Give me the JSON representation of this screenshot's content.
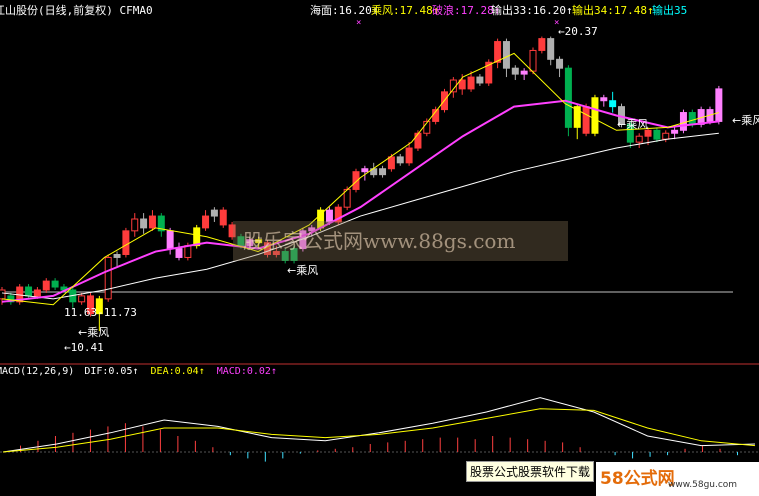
{
  "header": {
    "title": "江山股份(日线,前复权)",
    "indicator": "CFMA0",
    "items": [
      {
        "label": "海面:16.20↑",
        "color": "#ffffff"
      },
      {
        "label": "乘风:17.48↑",
        "color": "#ffff00"
      },
      {
        "label": "破浪:17.28↑",
        "color": "#ff40ff"
      },
      {
        "label": "输出33:16.20↑",
        "color": "#ffffff"
      },
      {
        "label": "输出34:17.48↑",
        "color": "#ffff00"
      },
      {
        "label": "输出35",
        "color": "#00ffff"
      }
    ]
  },
  "macd_header": {
    "name": "MACD(12,26,9)",
    "dif": "DIF:0.05↑",
    "dea": "DEA:0.04↑",
    "macd": "MACD:0.02↑"
  },
  "annotations": {
    "high": "20.37",
    "low": "10.41",
    "range": "11.63-11.73",
    "chengfeng": "乘风"
  },
  "watermark": "股乐家公式网www.88gs.com",
  "footer_text": "股票公式股票软件下载",
  "logo": {
    "brand": "58公式网",
    "site": "www.58gu.com"
  },
  "colors": {
    "up": "#ff3c3c",
    "down": "#00b050",
    "yellow": "#ffff00",
    "magenta": "#ff40ff",
    "white": "#ffffff",
    "cyan": "#00ffff",
    "pink": "#ff80ff",
    "gray": "#b0b0b0"
  },
  "chart_data": {
    "type": "candlestick",
    "ylim": [
      9.5,
      21.2
    ],
    "baseline_price": 11.73,
    "candles": [
      [
        11.5,
        11.8,
        11.3,
        11.9,
        "red"
      ],
      [
        11.6,
        11.4,
        11.3,
        11.7,
        "green"
      ],
      [
        11.4,
        11.9,
        11.3,
        12.0,
        "red"
      ],
      [
        11.9,
        11.6,
        11.5,
        12.0,
        "green"
      ],
      [
        11.6,
        11.8,
        11.5,
        11.9,
        "red"
      ],
      [
        11.8,
        12.1,
        11.7,
        12.2,
        "red"
      ],
      [
        12.1,
        11.9,
        11.8,
        12.2,
        "green"
      ],
      [
        11.9,
        11.8,
        11.7,
        12.0,
        "green"
      ],
      [
        11.8,
        11.4,
        11.2,
        11.9,
        "green"
      ],
      [
        11.4,
        11.6,
        11.3,
        11.7,
        "red"
      ],
      [
        11.6,
        11.0,
        10.9,
        11.7,
        "red"
      ],
      [
        11.0,
        11.5,
        10.41,
        11.6,
        "yellow"
      ],
      [
        11.5,
        12.9,
        11.4,
        13.0,
        "red"
      ],
      [
        12.9,
        13.0,
        12.6,
        13.1,
        "gray"
      ],
      [
        13.0,
        13.8,
        12.9,
        13.9,
        "red"
      ],
      [
        13.8,
        14.2,
        13.6,
        14.4,
        "red"
      ],
      [
        14.2,
        13.9,
        13.7,
        14.4,
        "gray"
      ],
      [
        13.9,
        14.3,
        13.8,
        14.5,
        "red"
      ],
      [
        14.3,
        13.8,
        13.6,
        14.4,
        "green"
      ],
      [
        13.8,
        13.2,
        13.0,
        13.9,
        "pink"
      ],
      [
        13.2,
        12.9,
        12.8,
        13.4,
        "pink"
      ],
      [
        12.9,
        13.3,
        12.8,
        13.4,
        "red"
      ],
      [
        13.3,
        13.9,
        13.2,
        14.0,
        "yellow"
      ],
      [
        13.9,
        14.3,
        13.8,
        14.5,
        "red"
      ],
      [
        14.3,
        14.5,
        14.1,
        14.6,
        "gray"
      ],
      [
        14.5,
        14.0,
        13.9,
        14.6,
        "red"
      ],
      [
        14.0,
        13.6,
        13.5,
        14.1,
        "red"
      ],
      [
        13.6,
        13.3,
        13.2,
        13.7,
        "green"
      ],
      [
        13.3,
        13.5,
        13.2,
        13.6,
        "pink"
      ],
      [
        13.5,
        13.4,
        13.2,
        13.6,
        "yellow"
      ],
      [
        13.4,
        13.0,
        12.9,
        13.5,
        "red"
      ],
      [
        13.0,
        13.1,
        12.9,
        13.3,
        "red"
      ],
      [
        13.1,
        12.8,
        12.7,
        13.2,
        "green"
      ],
      [
        12.8,
        13.2,
        12.7,
        13.3,
        "green"
      ],
      [
        13.2,
        13.8,
        13.1,
        13.9,
        "pink"
      ],
      [
        13.8,
        13.9,
        13.6,
        14.0,
        "pink"
      ],
      [
        13.9,
        14.5,
        13.8,
        14.6,
        "yellow"
      ],
      [
        14.5,
        14.1,
        14.0,
        14.6,
        "pink"
      ],
      [
        14.1,
        14.6,
        14.0,
        14.7,
        "red"
      ],
      [
        14.6,
        15.2,
        14.5,
        15.3,
        "red"
      ],
      [
        15.2,
        15.8,
        15.1,
        15.9,
        "red"
      ],
      [
        15.8,
        15.9,
        15.5,
        16.0,
        "pink"
      ],
      [
        15.9,
        15.7,
        15.6,
        16.1,
        "gray"
      ],
      [
        15.7,
        15.9,
        15.6,
        16.0,
        "gray"
      ],
      [
        15.9,
        16.3,
        15.8,
        16.4,
        "red"
      ],
      [
        16.3,
        16.1,
        16.0,
        16.4,
        "gray"
      ],
      [
        16.1,
        16.6,
        16.0,
        16.8,
        "red"
      ],
      [
        16.6,
        17.1,
        16.5,
        17.2,
        "red"
      ],
      [
        17.1,
        17.5,
        17.0,
        17.6,
        "red"
      ],
      [
        17.5,
        17.9,
        17.4,
        18.0,
        "red"
      ],
      [
        17.9,
        18.5,
        17.8,
        18.6,
        "red"
      ],
      [
        18.5,
        18.9,
        18.3,
        19.0,
        "red"
      ],
      [
        18.9,
        18.6,
        18.4,
        19.1,
        "red"
      ],
      [
        18.6,
        19.0,
        18.5,
        19.2,
        "red"
      ],
      [
        19.0,
        18.8,
        18.7,
        19.1,
        "gray"
      ],
      [
        18.8,
        19.5,
        18.7,
        19.6,
        "red"
      ],
      [
        19.5,
        20.2,
        19.3,
        20.3,
        "red"
      ],
      [
        20.2,
        19.3,
        19.0,
        20.3,
        "gray"
      ],
      [
        19.3,
        19.1,
        18.9,
        19.4,
        "gray"
      ],
      [
        19.1,
        19.2,
        18.9,
        19.3,
        "pink"
      ],
      [
        19.2,
        19.9,
        19.1,
        20.0,
        "red"
      ],
      [
        19.9,
        20.3,
        19.8,
        20.37,
        "red"
      ],
      [
        20.3,
        19.6,
        19.4,
        20.37,
        "gray"
      ],
      [
        19.6,
        19.3,
        19.0,
        19.7,
        "gray"
      ],
      [
        19.3,
        17.3,
        17.0,
        19.4,
        "green"
      ],
      [
        17.3,
        18.0,
        16.9,
        18.1,
        "yellow"
      ],
      [
        18.0,
        17.1,
        17.0,
        18.1,
        "red"
      ],
      [
        17.1,
        18.3,
        17.0,
        18.4,
        "yellow"
      ],
      [
        18.3,
        18.2,
        18.0,
        18.4,
        "pink"
      ],
      [
        18.2,
        18.0,
        17.8,
        18.5,
        "cyan"
      ],
      [
        18.0,
        17.4,
        17.3,
        18.1,
        "gray"
      ],
      [
        17.4,
        16.8,
        16.6,
        17.5,
        "green"
      ],
      [
        16.8,
        17.0,
        16.6,
        17.1,
        "red"
      ],
      [
        17.0,
        17.2,
        16.7,
        17.3,
        "red"
      ],
      [
        17.2,
        16.9,
        16.8,
        17.3,
        "green"
      ],
      [
        16.9,
        17.1,
        16.8,
        17.2,
        "red"
      ],
      [
        17.1,
        17.2,
        16.9,
        17.3,
        "pink"
      ],
      [
        17.2,
        17.8,
        17.1,
        17.9,
        "pink"
      ],
      [
        17.8,
        17.4,
        17.3,
        17.9,
        "green"
      ],
      [
        17.4,
        17.9,
        17.3,
        18.0,
        "pink"
      ],
      [
        17.9,
        17.5,
        17.4,
        18.0,
        "pink"
      ],
      [
        17.5,
        18.6,
        17.4,
        18.7,
        "pink"
      ]
    ],
    "lines": {
      "ma_slow_white": [
        [
          0,
          11.7
        ],
        [
          10,
          11.5
        ],
        [
          20,
          11.8
        ],
        [
          30,
          12.2
        ],
        [
          40,
          12.5
        ],
        [
          50,
          13.0
        ],
        [
          60,
          13.6
        ],
        [
          70,
          14.3
        ],
        [
          80,
          14.8
        ],
        [
          90,
          15.3
        ],
        [
          100,
          15.8
        ],
        [
          110,
          16.2
        ],
        [
          120,
          16.6
        ],
        [
          130,
          16.9
        ],
        [
          140,
          17.1
        ]
      ],
      "ma_mid_magenta": [
        [
          0,
          11.4
        ],
        [
          10,
          11.6
        ],
        [
          20,
          12.4
        ],
        [
          30,
          13.1
        ],
        [
          40,
          13.4
        ],
        [
          50,
          13.2
        ],
        [
          60,
          13.7
        ],
        [
          70,
          14.6
        ],
        [
          80,
          15.8
        ],
        [
          90,
          17.0
        ],
        [
          100,
          18.0
        ],
        [
          110,
          18.2
        ],
        [
          120,
          17.7
        ],
        [
          130,
          17.3
        ],
        [
          140,
          17.5
        ]
      ],
      "ma_fast_yellow": [
        [
          0,
          11.5
        ],
        [
          10,
          11.3
        ],
        [
          20,
          12.9
        ],
        [
          30,
          13.9
        ],
        [
          40,
          13.6
        ],
        [
          50,
          13.1
        ],
        [
          60,
          14.0
        ],
        [
          70,
          15.6
        ],
        [
          80,
          16.8
        ],
        [
          90,
          19.0
        ],
        [
          100,
          19.8
        ],
        [
          110,
          18.1
        ],
        [
          120,
          17.2
        ],
        [
          130,
          17.3
        ],
        [
          140,
          17.8
        ]
      ]
    },
    "macd": {
      "dif": [
        [
          0,
          0.0
        ],
        [
          10,
          0.05
        ],
        [
          20,
          0.12
        ],
        [
          30,
          0.2
        ],
        [
          40,
          0.16
        ],
        [
          50,
          0.09
        ],
        [
          60,
          0.07
        ],
        [
          70,
          0.12
        ],
        [
          80,
          0.18
        ],
        [
          90,
          0.25
        ],
        [
          100,
          0.34
        ],
        [
          110,
          0.25
        ],
        [
          120,
          0.1
        ],
        [
          130,
          0.04
        ],
        [
          140,
          0.05
        ]
      ],
      "dea": [
        [
          0,
          0.0
        ],
        [
          10,
          0.03
        ],
        [
          20,
          0.08
        ],
        [
          30,
          0.15
        ],
        [
          40,
          0.15
        ],
        [
          50,
          0.11
        ],
        [
          60,
          0.09
        ],
        [
          70,
          0.11
        ],
        [
          80,
          0.15
        ],
        [
          90,
          0.21
        ],
        [
          100,
          0.27
        ],
        [
          110,
          0.26
        ],
        [
          120,
          0.15
        ],
        [
          130,
          0.07
        ],
        [
          140,
          0.04
        ]
      ],
      "hist": [
        0.0,
        0.04,
        0.07,
        0.1,
        0.12,
        0.14,
        0.16,
        0.18,
        0.16,
        0.14,
        0.1,
        0.07,
        0.03,
        -0.02,
        -0.04,
        -0.06,
        -0.04,
        -0.01,
        0.01,
        0.02,
        0.03,
        0.05,
        0.06,
        0.07,
        0.08,
        0.09,
        0.09,
        0.08,
        0.1,
        0.09,
        0.08,
        0.07,
        0.06,
        0.03,
        0.0,
        -0.02,
        -0.04,
        -0.03,
        -0.02,
        0.02,
        0.04,
        0.02,
        -0.02
      ]
    }
  }
}
